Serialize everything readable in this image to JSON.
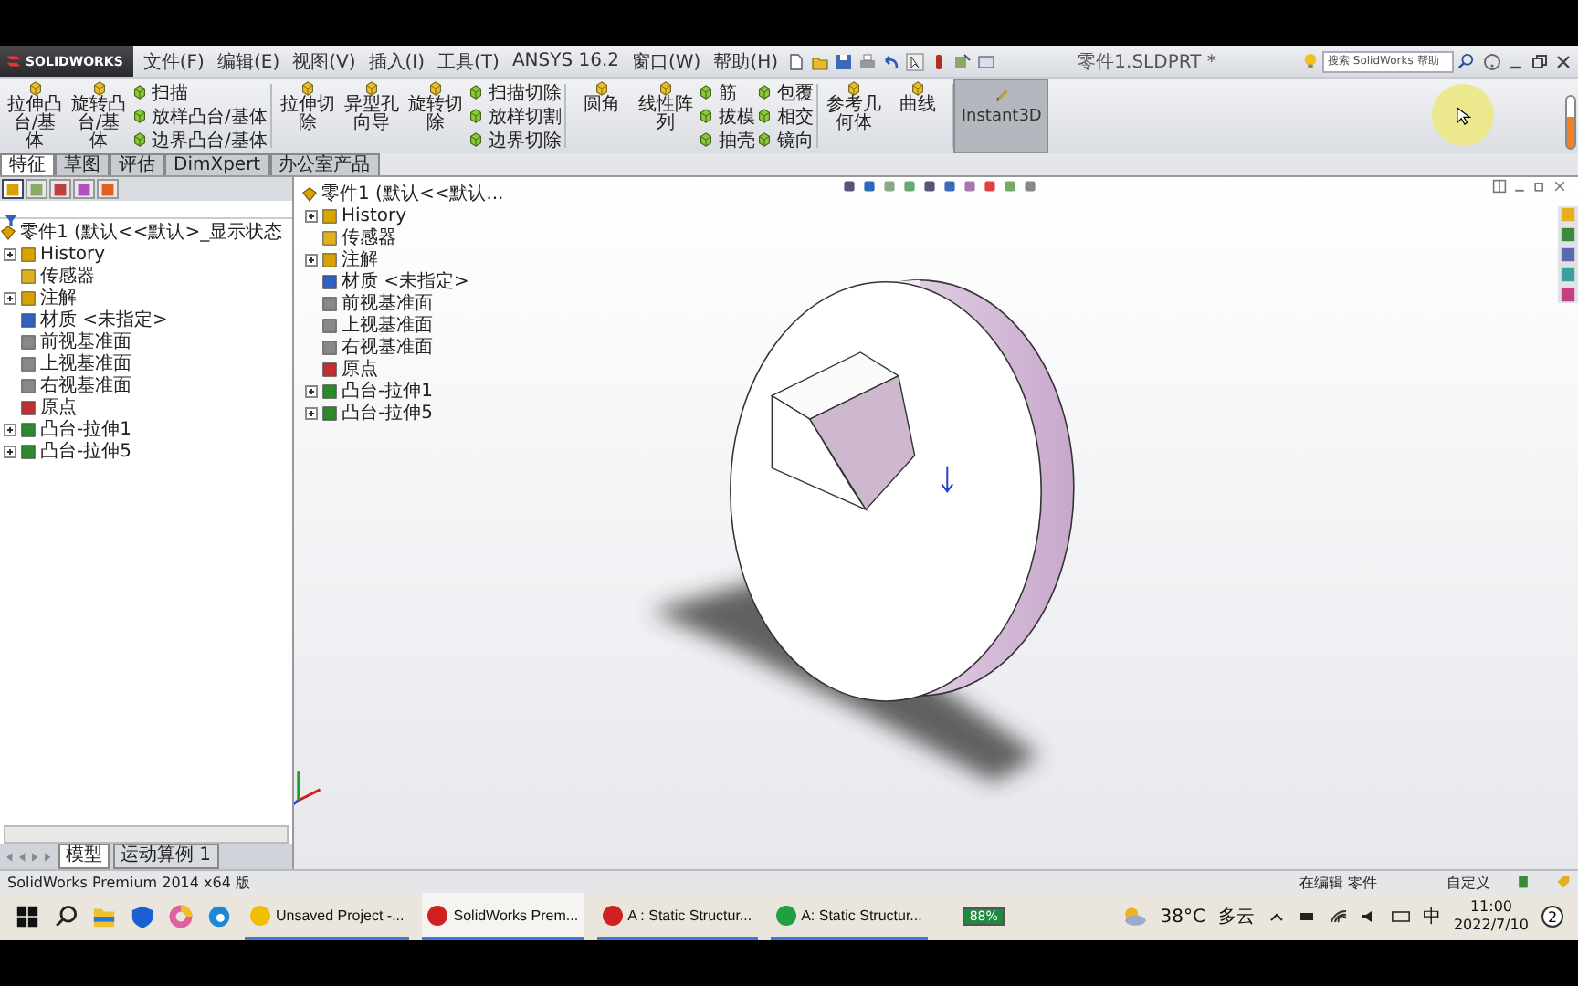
{
  "app": {
    "logo": "SOLIDWORKS",
    "menus": [
      "文件(F)",
      "编辑(E)",
      "视图(V)",
      "插入(I)",
      "工具(T)",
      "ANSYS 16.2",
      "窗口(W)",
      "帮助(H)"
    ],
    "title": "零件1.SLDPRT *",
    "search": {
      "placeholder": "搜索 SolidWorks 帮助"
    }
  },
  "ribbon": {
    "groups": [
      {
        "columns": [
          [
            {
              "kind": "large",
              "label": "拉伸凸台/基体"
            }
          ],
          [
            {
              "kind": "large",
              "label": "旋转凸台/基体"
            }
          ],
          [
            {
              "kind": "small",
              "label": "扫描"
            },
            {
              "kind": "small",
              "label": "放样凸台/基体"
            },
            {
              "kind": "small",
              "label": "边界凸台/基体"
            }
          ]
        ]
      },
      {
        "columns": [
          [
            {
              "kind": "large",
              "label": "拉伸切除"
            }
          ],
          [
            {
              "kind": "large",
              "label": "异型孔向导"
            }
          ],
          [
            {
              "kind": "large",
              "label": "旋转切除"
            }
          ],
          [
            {
              "kind": "small",
              "label": "扫描切除"
            },
            {
              "kind": "small",
              "label": "放样切割"
            },
            {
              "kind": "small",
              "label": "边界切除"
            }
          ]
        ]
      },
      {
        "columns": [
          [
            {
              "kind": "large",
              "label": "圆角"
            }
          ],
          [
            {
              "kind": "large",
              "label": "线性阵列"
            }
          ],
          [
            {
              "kind": "small",
              "label": "筋"
            },
            {
              "kind": "small",
              "label": "拔模"
            },
            {
              "kind": "small",
              "label": "抽壳"
            }
          ],
          [
            {
              "kind": "small",
              "label": "包覆"
            },
            {
              "kind": "small",
              "label": "相交"
            },
            {
              "kind": "small",
              "label": "镜向"
            }
          ]
        ]
      },
      {
        "columns": [
          [
            {
              "kind": "large",
              "label": "参考几何体"
            }
          ],
          [
            {
              "kind": "large",
              "label": "曲线"
            }
          ]
        ]
      }
    ],
    "toggle": {
      "label": "Instant3D",
      "selected": true
    }
  },
  "tabs": [
    {
      "label": "特征",
      "selected": true
    },
    {
      "label": "草图",
      "selected": false
    },
    {
      "label": "评估",
      "selected": false
    },
    {
      "label": "DimXpert",
      "selected": false
    },
    {
      "label": "办公室产品",
      "selected": false
    }
  ],
  "panel_tabs": [
    {
      "selected": true
    },
    {
      "selected": false
    },
    {
      "selected": false
    },
    {
      "selected": false
    },
    {
      "selected": false
    }
  ],
  "tree": {
    "root": "零件1 (默认<<默认>_显示状态",
    "nodes": [
      {
        "label": "History",
        "kind": "history",
        "expanded": false
      },
      {
        "label": "传感器",
        "kind": "sensor"
      },
      {
        "label": "注解",
        "kind": "annotation",
        "expanded": false
      },
      {
        "label": "材质 <未指定>",
        "kind": "material"
      },
      {
        "label": "前视基准面",
        "kind": "plane"
      },
      {
        "label": "上视基准面",
        "kind": "plane"
      },
      {
        "label": "右视基准面",
        "kind": "plane"
      },
      {
        "label": "原点",
        "kind": "origin"
      },
      {
        "label": "凸台-拉伸1",
        "kind": "feature",
        "expanded": false
      },
      {
        "label": "凸台-拉伸5",
        "kind": "feature",
        "expanded": false
      }
    ]
  },
  "overlay_tree": {
    "root": "零件1 (默认<<默认...",
    "nodes": [
      {
        "label": "History",
        "kind": "history",
        "expanded": false
      },
      {
        "label": "传感器",
        "kind": "sensor"
      },
      {
        "label": "注解",
        "kind": "annotation",
        "expanded": false
      },
      {
        "label": "材质 <未指定>",
        "kind": "material"
      },
      {
        "label": "前视基准面",
        "kind": "plane"
      },
      {
        "label": "上视基准面",
        "kind": "plane"
      },
      {
        "label": "右视基准面",
        "kind": "plane"
      },
      {
        "label": "原点",
        "kind": "origin"
      },
      {
        "label": "凸台-拉伸1",
        "kind": "feature",
        "expanded": false
      },
      {
        "label": "凸台-拉伸5",
        "kind": "feature",
        "expanded": false
      }
    ]
  },
  "model_tabs": [
    {
      "label": "模型",
      "selected": true
    },
    {
      "label": "运动算例 1",
      "selected": false
    }
  ],
  "status_bar": {
    "text": "SolidWorks Premium 2014 x64 版",
    "mode": "在编辑 零件",
    "units": "自定义"
  },
  "taskbar": {
    "apps": [
      {
        "label": "Unsaved Project -...",
        "kind": "ansys",
        "selected": false
      },
      {
        "label": "SolidWorks Prem...",
        "kind": "solidworks",
        "selected": true
      },
      {
        "label": "A : Static Structur...",
        "kind": "mechanical",
        "selected": false
      },
      {
        "label": "A: Static Structur...",
        "kind": "designmodeler",
        "selected": false
      }
    ],
    "battery": "88%",
    "temperature": "38°C",
    "weather": "多云",
    "ime": "中",
    "time": "11:00",
    "date": "2022/7/10",
    "notifications": "2"
  }
}
